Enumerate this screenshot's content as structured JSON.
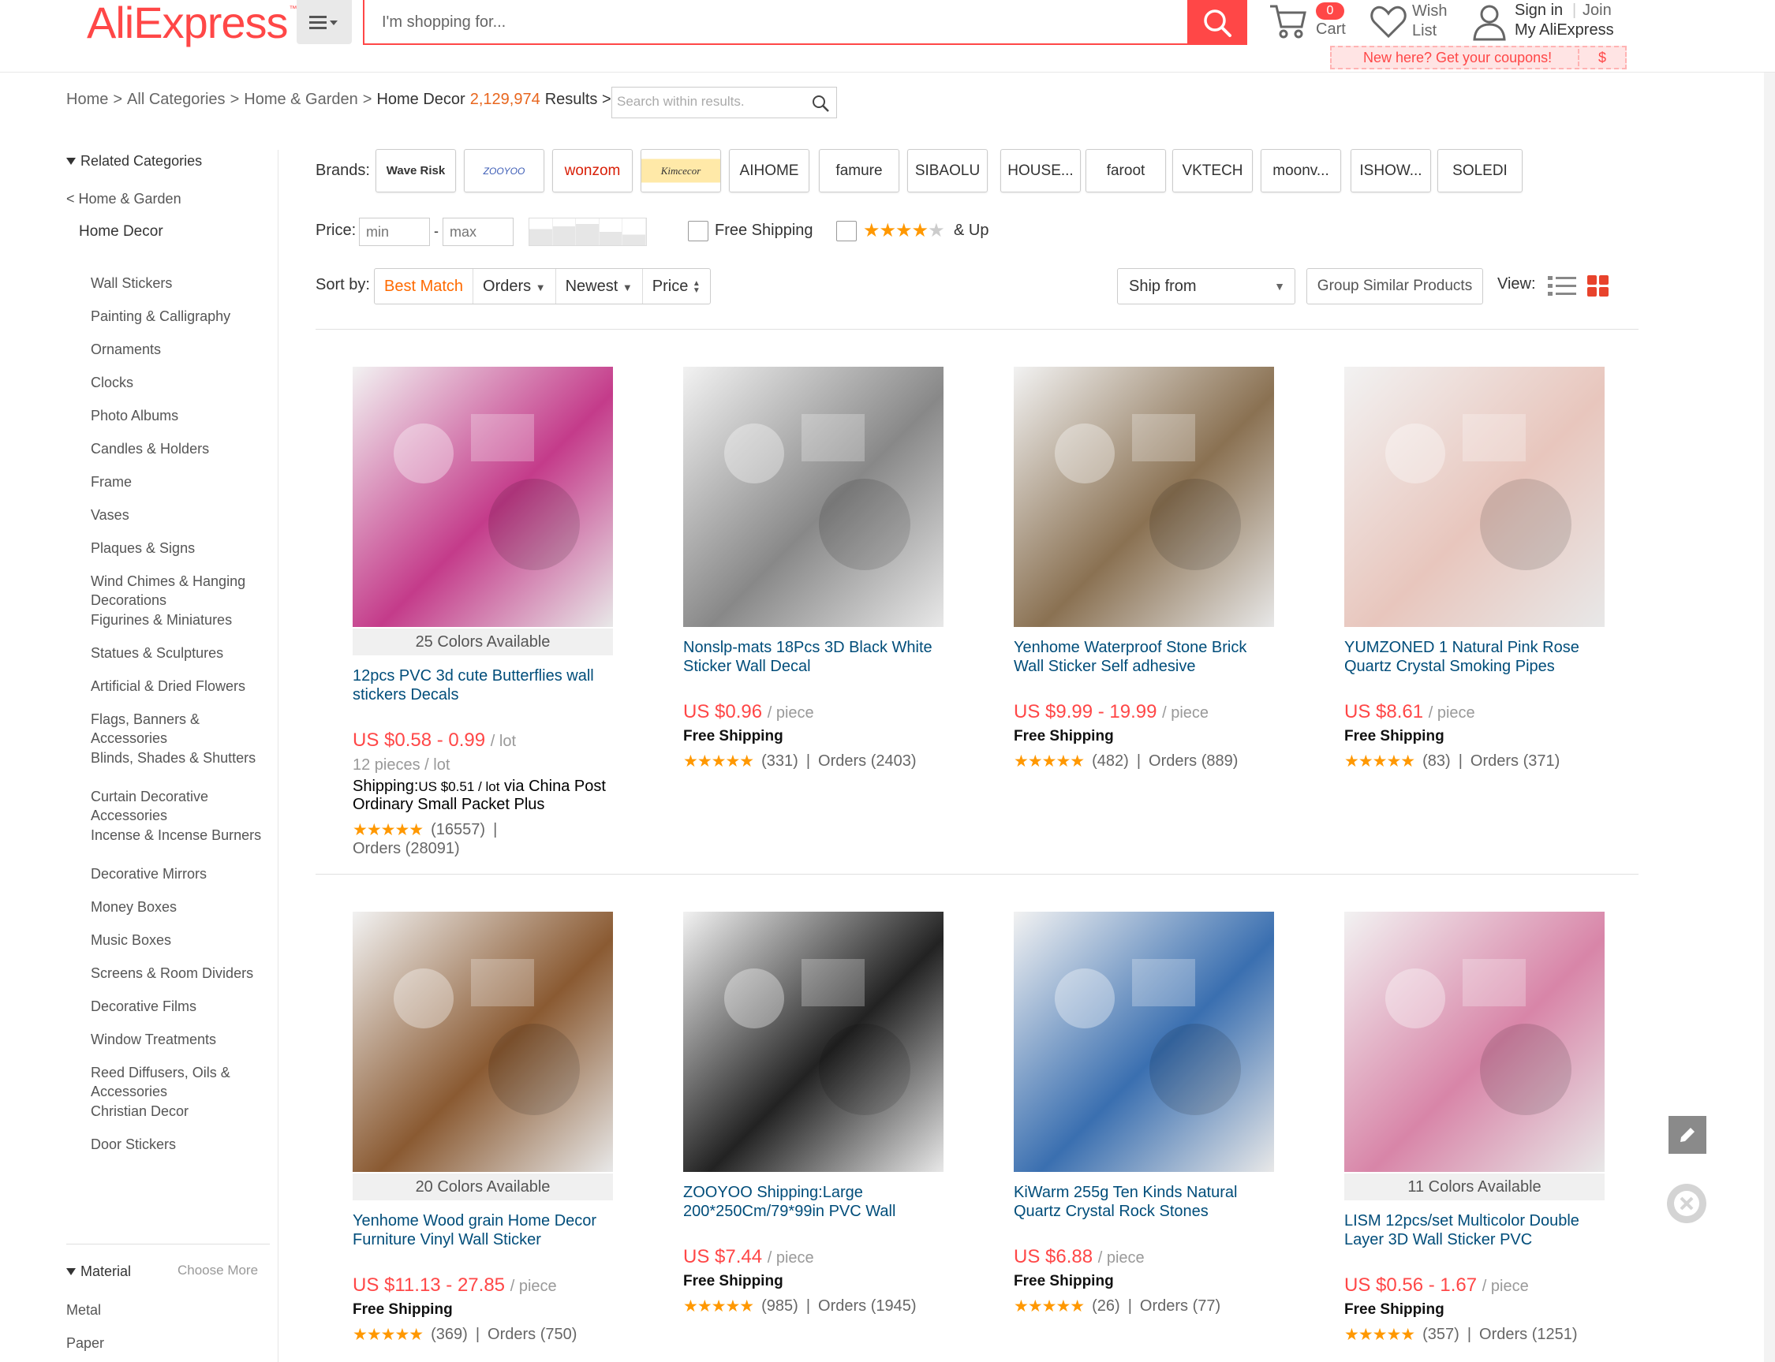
{
  "header": {
    "logo": "AliExpress",
    "logo_tm": "™",
    "search_placeholder": "I'm shopping for...",
    "cart_count": "0",
    "cart_label": "Cart",
    "wish_label": "Wish List",
    "signin": "Sign in",
    "separator": "|",
    "join": "Join",
    "my_aliexpress": "My AliExpress",
    "coupon_text": "New here? Get your coupons!",
    "coupon_symbol": "$"
  },
  "breadcrumb": {
    "items": [
      "Home",
      "All Categories",
      "Home & Garden",
      "Home Decor"
    ],
    "separator": ">",
    "count": "2,129,974",
    "results_label": "Results >",
    "search_within_placeholder": "Search within results."
  },
  "sidebar": {
    "related_heading": "Related Categories",
    "back": "< Home & Garden",
    "current": "Home Decor",
    "categories": [
      "Wall Stickers",
      "Painting & Calligraphy",
      "Ornaments",
      "Clocks",
      "Photo Albums",
      "Candles & Holders",
      "Frame",
      "Vases",
      "Plaques & Signs",
      "Wind Chimes & Hanging Decorations",
      "Figurines & Miniatures",
      "Statues & Sculptures",
      "Artificial & Dried Flowers",
      "Flags, Banners & Accessories",
      "Blinds, Shades & Shutters",
      "Curtain Decorative Accessories",
      "Incense & Incense Burners",
      "Decorative Mirrors",
      "Money Boxes",
      "Music Boxes",
      "Screens & Room Dividers",
      "Decorative Films",
      "Window Treatments",
      "Reed Diffusers, Oils & Accessories",
      "Christian Decor",
      "Door Stickers"
    ],
    "material_heading": "Material",
    "choose_more": "Choose More",
    "materials": [
      "Metal",
      "Paper"
    ]
  },
  "filters": {
    "brands_label": "Brands:",
    "brands": [
      "Wave Risk",
      "ZOOYOO",
      "wonzom",
      "Kimcecor",
      "AIHOME",
      "famure",
      "SIBAOLU",
      "HOUSE...",
      "faroot",
      "VKTECH",
      "moonv...",
      "ISHOW...",
      "SOLEDI"
    ],
    "price_label": "Price:",
    "min_placeholder": "min",
    "dash": "-",
    "max_placeholder": "max",
    "free_shipping": "Free Shipping",
    "stars_up": "& Up",
    "sort_label": "Sort by:",
    "sort_options": [
      "Best Match",
      "Orders",
      "Newest",
      "Price"
    ],
    "ship_from": "Ship from",
    "group_similar": "Group Similar Products",
    "view_label": "View:"
  },
  "products": [
    {
      "title": "12pcs PVC 3d cute Butterflies wall stickers Decals",
      "colors": "25 Colors Available",
      "price": "US $0.58 - 0.99",
      "unit": "/ lot",
      "sub": "12 pieces / lot",
      "ship_label": "Shipping:",
      "ship_price": "US $0.51 / lot",
      "ship_via": " via China Post Ordinary Small Packet Plus",
      "reviews": "(16557)",
      "orders": "Orders (28091)",
      "accent": "#c43b8a"
    },
    {
      "title": "Nonslp-mats 18Pcs 3D Black White Sticker Wall Decal",
      "colors": "",
      "price": "US $0.96",
      "unit": "/ piece",
      "ship": "Free Shipping",
      "reviews": "(331)",
      "orders": "Orders (2403)",
      "accent": "#888888"
    },
    {
      "title": "Yenhome Waterproof Stone Brick Wall Sticker Self adhesive",
      "colors": "",
      "price": "US $9.99 - 19.99",
      "unit": "/ piece",
      "ship": "Free Shipping",
      "reviews": "(482)",
      "orders": "Orders (889)",
      "accent": "#8a7152"
    },
    {
      "title": "YUMZONED 1 Natural Pink Rose Quartz Crystal Smoking Pipes",
      "colors": "",
      "price": "US $8.61",
      "unit": "/ piece",
      "ship": "Free Shipping",
      "reviews": "(83)",
      "orders": "Orders (371)",
      "accent": "#e8c6bd"
    },
    {
      "title": "Yenhome Wood grain Home Decor Furniture Vinyl Wall Sticker",
      "colors": "20 Colors Available",
      "price": "US $11.13 - 27.85",
      "unit": "/ piece",
      "ship": "Free Shipping",
      "reviews": "(369)",
      "orders": "Orders (750)",
      "accent": "#8a5a32"
    },
    {
      "title": "ZOOYOO Shipping:Large 200*250Cm/79*99in PVC Wall",
      "colors": "",
      "price": "US $7.44",
      "unit": "/ piece",
      "ship": "Free Shipping",
      "reviews": "(985)",
      "orders": "Orders (1945)",
      "accent": "#222222"
    },
    {
      "title": "KiWarm 255g Ten Kinds Natural Quartz Crystal Rock Stones",
      "colors": "",
      "price": "US $6.88",
      "unit": "/ piece",
      "ship": "Free Shipping",
      "reviews": "(26)",
      "orders": "Orders (77)",
      "accent": "#3a6fb0"
    },
    {
      "title": "LISM 12pcs/set Multicolor Double Layer 3D Wall Sticker PVC",
      "colors": "11 Colors Available",
      "price": "US $0.56 - 1.67",
      "unit": "/ piece",
      "ship": "Free Shipping",
      "reviews": "(357)",
      "orders": "Orders (1251)",
      "accent": "#d885a8"
    }
  ],
  "rating_separator": "|",
  "stars_glyph": "★★★★★",
  "colors": {
    "brand": "#ff4747",
    "link": "#004d7a",
    "price": "#ff4747",
    "sort_active": "#ff6a00",
    "star": "#ff9800"
  }
}
